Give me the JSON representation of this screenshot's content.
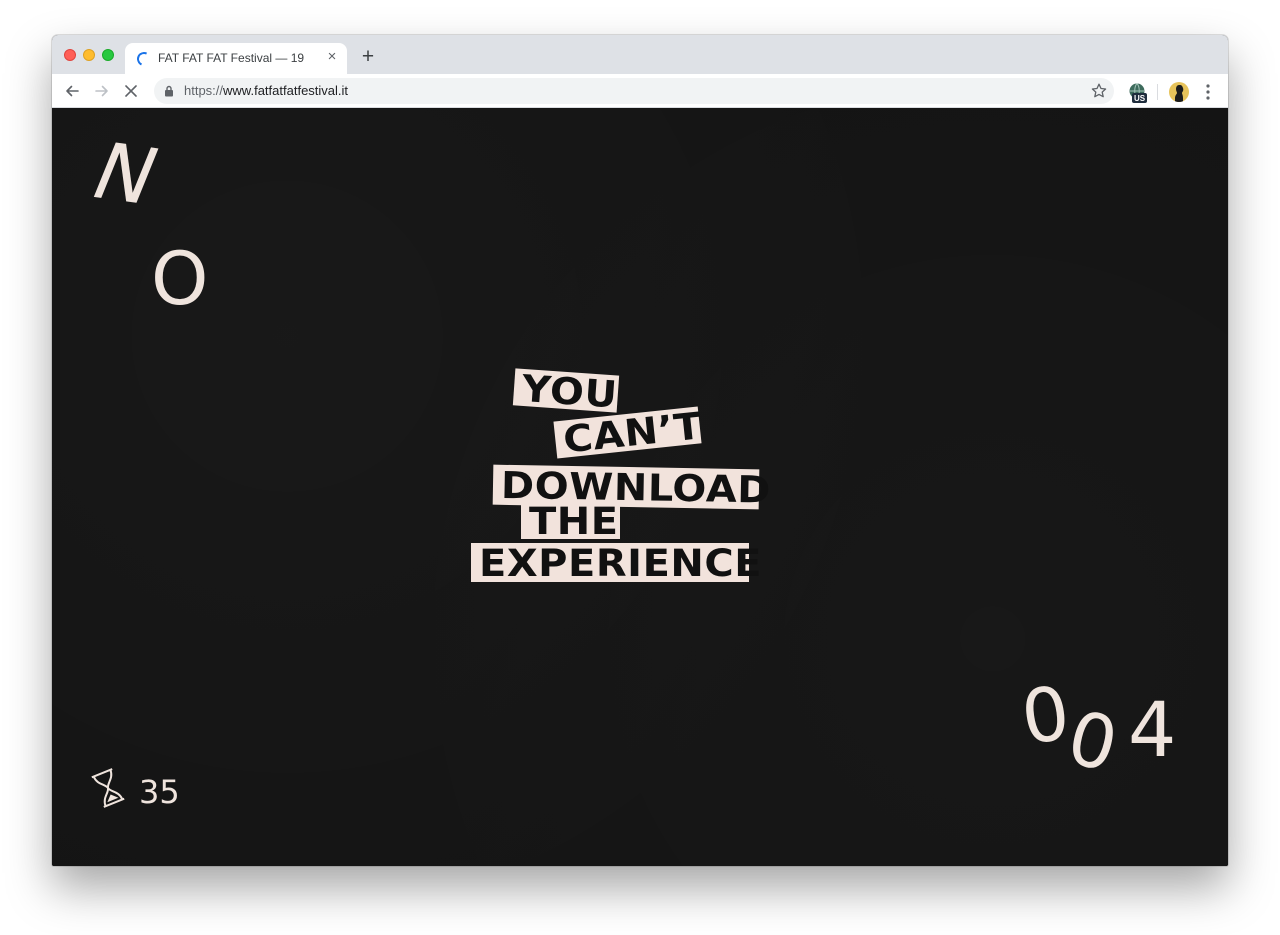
{
  "browser": {
    "tab": {
      "title": "FAT FAT FAT Festival — 19",
      "close_glyph": "×"
    },
    "new_tab_glyph": "+",
    "url_scheme": "https://",
    "url_host": "www.fatfatfatfestival.it",
    "extension_badge": "US"
  },
  "page": {
    "corner_letters": [
      "N",
      "O"
    ],
    "number_digits": [
      "0",
      "0",
      "4"
    ],
    "counter": "35",
    "slogan_lines": [
      "YOU",
      "CAN’T",
      "DOWNLOAD",
      "THE",
      "EXPERIENCE"
    ],
    "colors": {
      "background": "#141414",
      "foreground": "#efe4dd",
      "slab": "#f2e3dc",
      "slab_text": "#111111"
    }
  }
}
